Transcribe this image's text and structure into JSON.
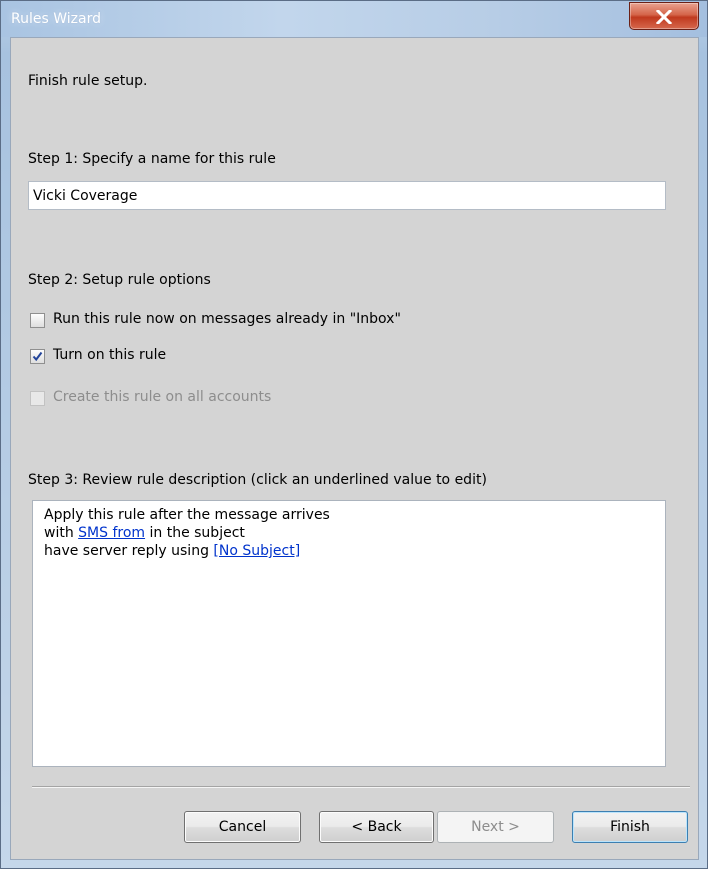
{
  "window": {
    "title": "Rules Wizard",
    "close_icon": "close-icon"
  },
  "header": {
    "text": "Finish rule setup."
  },
  "step1": {
    "label": "Step 1: Specify a name for this rule",
    "name_value": "Vicki Coverage"
  },
  "step2": {
    "label": "Step 2: Setup rule options",
    "options": [
      {
        "label": "Run this rule now on messages already in \"Inbox\"",
        "checked": false,
        "enabled": true
      },
      {
        "label": "Turn on this rule",
        "checked": true,
        "enabled": true
      },
      {
        "label": "Create this rule on all accounts",
        "checked": false,
        "enabled": false
      }
    ]
  },
  "step3": {
    "label": "Step 3: Review rule description (click an underlined value to edit)",
    "lines": [
      {
        "prefix": "Apply this rule after the message arrives",
        "link": "",
        "suffix": ""
      },
      {
        "prefix": "with ",
        "link": "SMS from",
        "suffix": " in the subject"
      },
      {
        "prefix": "have server reply using ",
        "link": "[No Subject]",
        "suffix": ""
      }
    ]
  },
  "buttons": {
    "cancel": "Cancel",
    "back": "< Back",
    "next": "Next >",
    "finish": "Finish"
  },
  "colors": {
    "link": "#0033cc",
    "dialog_bg": "#d4d4d4",
    "close_button": "#c7432a"
  }
}
